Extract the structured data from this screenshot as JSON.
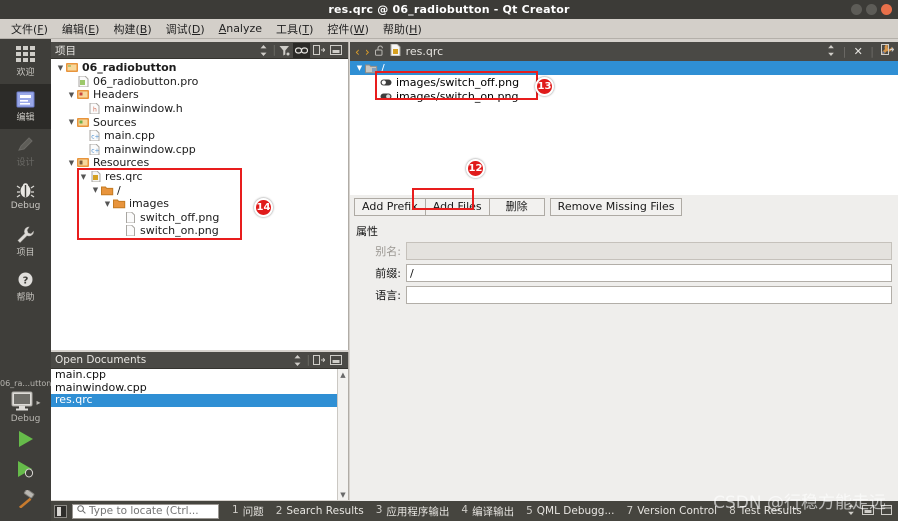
{
  "window": {
    "title": "res.qrc @ 06_radiobutton - Qt Creator",
    "buttons": {
      "minimize": "minimize",
      "maximize": "maximize",
      "close": "close"
    }
  },
  "menubar": [
    {
      "label": "文件",
      "accel": "F"
    },
    {
      "label": "编辑",
      "accel": "E"
    },
    {
      "label": "构建",
      "accel": "B"
    },
    {
      "label": "调试",
      "accel": "D"
    },
    {
      "label": "Analyze",
      "accel": "A"
    },
    {
      "label": "工具",
      "accel": "T"
    },
    {
      "label": "控件",
      "accel": "W"
    },
    {
      "label": "帮助",
      "accel": "H"
    }
  ],
  "modebar": {
    "modes": [
      {
        "label": "欢迎",
        "icon": "grid-icon",
        "state": "normal"
      },
      {
        "label": "编辑",
        "icon": "editor-icon",
        "state": "active"
      },
      {
        "label": "设计",
        "icon": "pencil-icon",
        "state": "disabled"
      },
      {
        "label": "Debug",
        "icon": "bug-icon",
        "state": "normal"
      },
      {
        "label": "项目",
        "icon": "wrench-icon",
        "state": "normal"
      },
      {
        "label": "帮助",
        "icon": "question-icon",
        "state": "normal"
      }
    ],
    "kit_selector": {
      "project": "06_ra...utton",
      "config": "Debug",
      "icon": "monitor-icon"
    },
    "run_buttons": [
      {
        "name": "run",
        "icon": "play-icon"
      },
      {
        "name": "debug",
        "icon": "play-debug-icon"
      },
      {
        "name": "build",
        "icon": "hammer-icon"
      }
    ]
  },
  "projects_panel": {
    "title": "项目",
    "toolbar": [
      {
        "name": "filter-sort-icon",
        "active": false
      },
      {
        "name": "filter-icon",
        "active": false
      },
      {
        "name": "sync-link-icon",
        "active": true
      },
      {
        "name": "split-icon",
        "active": false
      },
      {
        "name": "minimize-icon",
        "active": false
      }
    ],
    "tree": [
      {
        "depth": 0,
        "label": "06_radiobutton",
        "icon": "project-icon",
        "arrow": "open",
        "bold": true
      },
      {
        "depth": 1,
        "label": "06_radiobutton.pro",
        "icon": "pro-file-icon",
        "arrow": "none"
      },
      {
        "depth": 1,
        "label": "Headers",
        "icon": "folder-red-icon",
        "arrow": "open"
      },
      {
        "depth": 2,
        "label": "mainwindow.h",
        "icon": "h-file-icon",
        "arrow": "none"
      },
      {
        "depth": 1,
        "label": "Sources",
        "icon": "folder-green-icon",
        "arrow": "open"
      },
      {
        "depth": 2,
        "label": "main.cpp",
        "icon": "cpp-file-icon",
        "arrow": "none"
      },
      {
        "depth": 2,
        "label": "mainwindow.cpp",
        "icon": "cpp-file-icon",
        "arrow": "none"
      },
      {
        "depth": 1,
        "label": "Resources",
        "icon": "folder-res-icon",
        "arrow": "open"
      },
      {
        "depth": 2,
        "label": "res.qrc",
        "icon": "qrc-file-icon",
        "arrow": "open"
      },
      {
        "depth": 3,
        "label": "/",
        "icon": "folder-icon",
        "arrow": "open"
      },
      {
        "depth": 4,
        "label": "images",
        "icon": "folder-icon",
        "arrow": "open"
      },
      {
        "depth": 5,
        "label": "switch_off.png",
        "icon": "image-file-icon",
        "arrow": "none"
      },
      {
        "depth": 5,
        "label": "switch_on.png",
        "icon": "image-file-icon",
        "arrow": "none"
      }
    ]
  },
  "open_documents": {
    "title": "Open Documents",
    "toolbar": [
      {
        "name": "sort-icon"
      },
      {
        "name": "split-icon"
      },
      {
        "name": "minimize-icon"
      }
    ],
    "items": [
      {
        "label": "main.cpp",
        "selected": false
      },
      {
        "label": "mainwindow.cpp",
        "selected": false
      },
      {
        "label": "res.qrc",
        "selected": true
      }
    ]
  },
  "editor": {
    "toolbar": {
      "back_icon": "chevron-left-icon",
      "forward_icon": "chevron-right-icon",
      "lock_icon": "unlock-icon",
      "file_icon": "qrc-file-icon",
      "filename": "res.qrc",
      "updown_icon": "updown-icon",
      "close_icon": "close-icon",
      "config_icon": "tools-icon",
      "split_icon": "split-icon"
    },
    "qrc_tree": [
      {
        "depth": 0,
        "label": "/",
        "icon": "prefix-folder-icon",
        "arrow": "open",
        "selected": true
      },
      {
        "depth": 1,
        "label": "images/switch_off.png",
        "icon": "switch-off-icon",
        "arrow": "none",
        "selected": false
      },
      {
        "depth": 1,
        "label": "images/switch_on.png",
        "icon": "switch-on-icon",
        "arrow": "none",
        "selected": false
      }
    ],
    "buttons": [
      {
        "label": "Add Prefix",
        "name": "add-prefix-button",
        "highlighted": false
      },
      {
        "label": "Add Files",
        "name": "add-files-button",
        "highlighted": true
      },
      {
        "label": "删除",
        "name": "remove-button",
        "highlighted": false
      },
      {
        "label": "Remove Missing Files",
        "name": "remove-missing-files-button",
        "highlighted": false
      }
    ],
    "properties": {
      "heading": "属性",
      "fields": [
        {
          "label": "别名:",
          "value": "",
          "disabled": true,
          "name": "alias-field"
        },
        {
          "label": "前缀:",
          "value": "/",
          "disabled": false,
          "name": "prefix-field"
        },
        {
          "label": "语言:",
          "value": "",
          "disabled": false,
          "name": "language-field"
        }
      ]
    }
  },
  "statusbar": {
    "locate": {
      "placeholder": "Type to locate (Ctrl...",
      "icon": "search-icon"
    },
    "panel_toggle_icon": "sidebar-toggle-icon",
    "items": [
      {
        "num": "1",
        "label": "问题"
      },
      {
        "num": "2",
        "label": "Search Results"
      },
      {
        "num": "3",
        "label": "应用程序输出"
      },
      {
        "num": "4",
        "label": "编译输出"
      },
      {
        "num": "5",
        "label": "QML Debugg..."
      },
      {
        "num": "7",
        "label": "Version Control"
      },
      {
        "num": "8",
        "label": "Test Results"
      }
    ],
    "right_icons": [
      "updown-icon",
      "maximize-output-icon",
      "close-output-icon"
    ]
  },
  "annotations": {
    "badges": [
      {
        "label": "12",
        "name": "annotation-badge-12"
      },
      {
        "label": "13",
        "name": "annotation-badge-13"
      },
      {
        "label": "14",
        "name": "annotation-badge-14"
      }
    ],
    "highlight_color": "#e81d1d"
  },
  "watermark": {
    "text": "CSDN @行稳方能走远"
  },
  "colors": {
    "accent_selection": "#2f8fd4",
    "chrome_dark": "#3f3e3a",
    "annotation_red": "#e81d1d",
    "title_bar": "#3c3b37"
  }
}
